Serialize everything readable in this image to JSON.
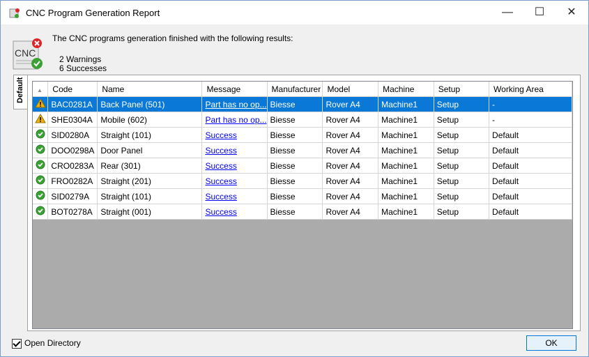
{
  "window": {
    "title": "CNC Program Generation Report"
  },
  "header": {
    "icon_label": "CNC",
    "summary": "The CNC programs generation finished with the following results:",
    "warnings": "2 Warnings",
    "successes": "6 Successes"
  },
  "tab": {
    "label": "Default"
  },
  "grid": {
    "columns": [
      "Code",
      "Name",
      "Message",
      "Manufacturer",
      "Model",
      "Machine",
      "Setup",
      "Working Area"
    ],
    "rows": [
      {
        "status": "warning",
        "code": "BAC0281A",
        "name": "Back Panel (501)",
        "message": "Part has no op...",
        "manufacturer": "Biesse",
        "model": "Rover A4",
        "machine": "Machine1",
        "setup": "Setup",
        "area": "-"
      },
      {
        "status": "warning",
        "code": "SHE0304A",
        "name": "Mobile (602)",
        "message": "Part has no op...",
        "manufacturer": "Biesse",
        "model": "Rover A4",
        "machine": "Machine1",
        "setup": "Setup",
        "area": "-"
      },
      {
        "status": "success",
        "code": "SID0280A",
        "name": "Straight (101)",
        "message": "Success",
        "manufacturer": "Biesse",
        "model": "Rover A4",
        "machine": "Machine1",
        "setup": "Setup",
        "area": "Default"
      },
      {
        "status": "success",
        "code": "DOO0298A",
        "name": "Door Panel",
        "message": "Success",
        "manufacturer": "Biesse",
        "model": "Rover A4",
        "machine": "Machine1",
        "setup": "Setup",
        "area": "Default"
      },
      {
        "status": "success",
        "code": "CRO0283A",
        "name": "Rear (301)",
        "message": "Success",
        "manufacturer": "Biesse",
        "model": "Rover A4",
        "machine": "Machine1",
        "setup": "Setup",
        "area": "Default"
      },
      {
        "status": "success",
        "code": "FRO0282A",
        "name": "Straight (201)",
        "message": "Success",
        "manufacturer": "Biesse",
        "model": "Rover A4",
        "machine": "Machine1",
        "setup": "Setup",
        "area": "Default"
      },
      {
        "status": "success",
        "code": "SID0279A",
        "name": "Straight (101)",
        "message": "Success",
        "manufacturer": "Biesse",
        "model": "Rover A4",
        "machine": "Machine1",
        "setup": "Setup",
        "area": "Default"
      },
      {
        "status": "success",
        "code": "BOT0278A",
        "name": "Straight (001)",
        "message": "Success",
        "manufacturer": "Biesse",
        "model": "Rover A4",
        "machine": "Machine1",
        "setup": "Setup",
        "area": "Default"
      }
    ]
  },
  "footer": {
    "open_directory_label": "Open Directory",
    "open_directory_checked": true,
    "ok_label": "OK"
  },
  "colors": {
    "selection": "#0a78d7",
    "warning": "#f2b400",
    "success": "#3ba135",
    "link": "#0000ee"
  }
}
